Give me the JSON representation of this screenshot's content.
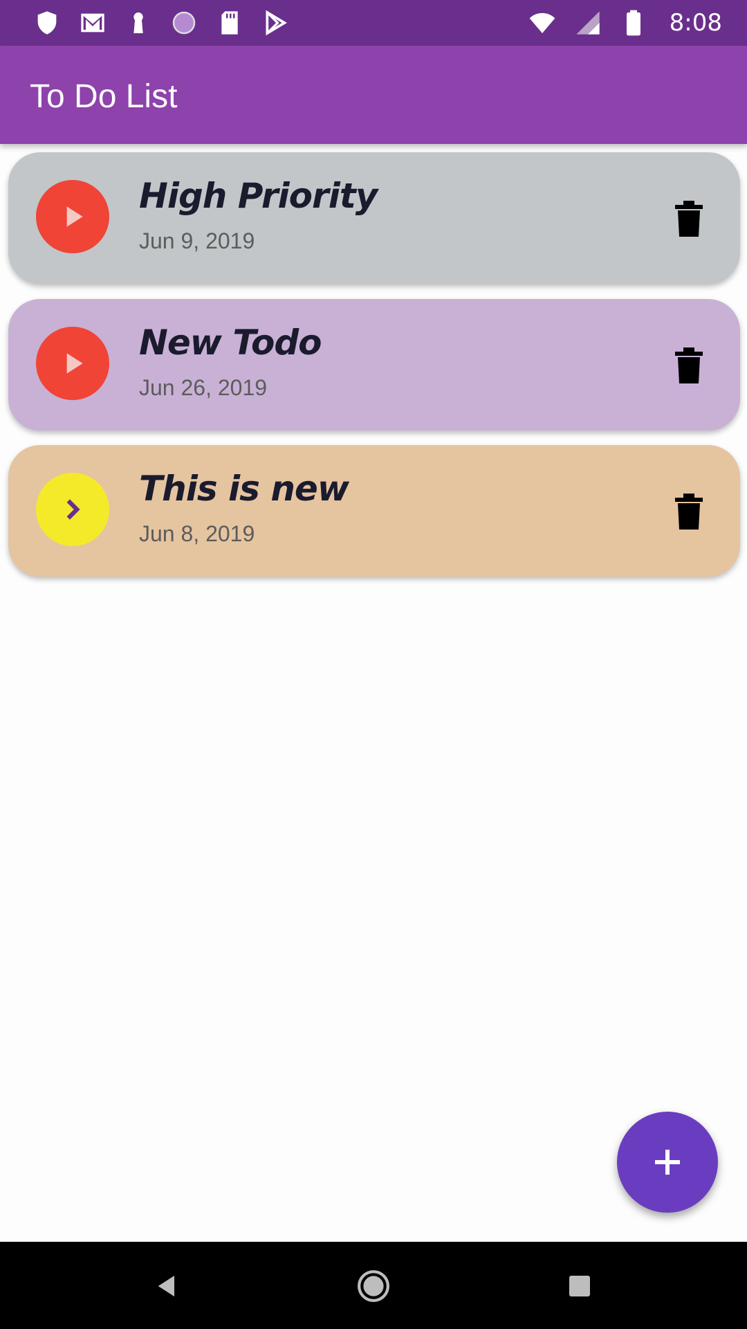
{
  "status_bar": {
    "time": "8:08",
    "left_icons": [
      "shield-icon",
      "mail-icon",
      "keyhole-icon",
      "circle-icon",
      "sd-card-icon",
      "play-store-icon"
    ],
    "right_icons": [
      "wifi-icon",
      "signal-icon",
      "battery-icon"
    ]
  },
  "app_bar": {
    "title": "To Do List"
  },
  "todos": [
    {
      "title": "High Priority",
      "date": "Jun 9, 2019",
      "status_icon": "play-icon",
      "status_color": "#f04437",
      "card_color": "#c2c6c9"
    },
    {
      "title": "New Todo",
      "date": "Jun 26, 2019",
      "status_icon": "play-icon",
      "status_color": "#f04437",
      "card_color": "#c9b1d6"
    },
    {
      "title": "This is new",
      "date": "Jun 8, 2019",
      "status_icon": "chevron-right-icon",
      "status_color": "#f5ea2a",
      "card_color": "#e5c4a0"
    }
  ],
  "fab": {
    "icon": "plus-icon",
    "color": "#6a3dc0"
  },
  "nav_bar": {
    "icons": [
      "back-icon",
      "home-icon",
      "recents-icon"
    ]
  },
  "colors": {
    "status_bar": "#6a2f8c",
    "app_bar": "#8e42ab"
  }
}
